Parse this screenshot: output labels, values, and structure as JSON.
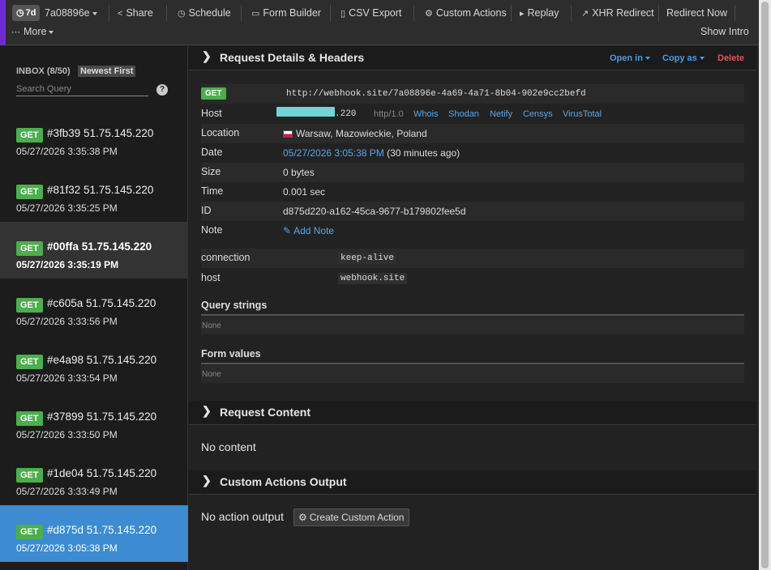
{
  "toolbar": {
    "range": "7d",
    "token": "7a08896e",
    "share": "Share",
    "schedule": "Schedule",
    "form_builder": "Form Builder",
    "csv_export": "CSV Export",
    "custom_actions": "Custom Actions",
    "replay": "Replay",
    "xhr_redirect": "XHR Redirect",
    "redirect_now": "Redirect Now",
    "more": "More",
    "show_intro": "Show Intro"
  },
  "sidebar": {
    "inbox_label": "INBOX (8/50)",
    "sort": "Newest First",
    "search_placeholder": "Search Query",
    "help": "?",
    "requests": [
      {
        "method": "GET",
        "title": "#3fb39 51.75.145.220",
        "date": "05/27/2026 3:35:38 PM"
      },
      {
        "method": "GET",
        "title": "#81f32 51.75.145.220",
        "date": "05/27/2026 3:35:25 PM"
      },
      {
        "method": "GET",
        "title": "#00ffa 51.75.145.220",
        "date": "05/27/2026 3:35:19 PM"
      },
      {
        "method": "GET",
        "title": "#c605a 51.75.145.220",
        "date": "05/27/2026 3:33:56 PM"
      },
      {
        "method": "GET",
        "title": "#e4a98 51.75.145.220",
        "date": "05/27/2026 3:33:54 PM"
      },
      {
        "method": "GET",
        "title": "#37899 51.75.145.220",
        "date": "05/27/2026 3:33:50 PM"
      },
      {
        "method": "GET",
        "title": "#1de04 51.75.145.220",
        "date": "05/27/2026 3:33:49 PM"
      },
      {
        "method": "GET",
        "title": "#d875d 51.75.145.220",
        "date": "05/27/2026 3:05:38 PM"
      }
    ]
  },
  "details": {
    "title": "Request Details & Headers",
    "open_in": "Open in",
    "copy_as": "Copy as",
    "delete": "Delete",
    "method": "GET",
    "url": "http://webhook.site/7a08896e-4a69-4a71-8b04-902e9cc2befd",
    "host_label": "Host",
    "host_suffix": ".220",
    "http_version": "http/1.0",
    "host_links": [
      "Whois",
      "Shodan",
      "Netify",
      "Censys",
      "VirusTotal"
    ],
    "location_label": "Location",
    "location": "Warsaw, Mazowieckie, Poland",
    "date_label": "Date",
    "date": "05/27/2026 3:05:38 PM",
    "date_relative": "(30 minutes ago)",
    "size_label": "Size",
    "size": "0 bytes",
    "time_label": "Time",
    "time": "0.001 sec",
    "id_label": "ID",
    "id": "d875d220-a162-45ca-9677-b179802fee5d",
    "note_label": "Note",
    "add_note": "Add Note",
    "headers": [
      {
        "name": "connection",
        "value": "keep-alive"
      },
      {
        "name": "host",
        "value": "webhook.site"
      }
    ],
    "query_strings_title": "Query strings",
    "query_strings_value": "None",
    "form_values_title": "Form values",
    "form_values_value": "None"
  },
  "content": {
    "title": "Request Content",
    "text": "No content"
  },
  "custom_output": {
    "title": "Custom Actions Output",
    "text": "No action output",
    "create_button": "Create Custom Action"
  }
}
